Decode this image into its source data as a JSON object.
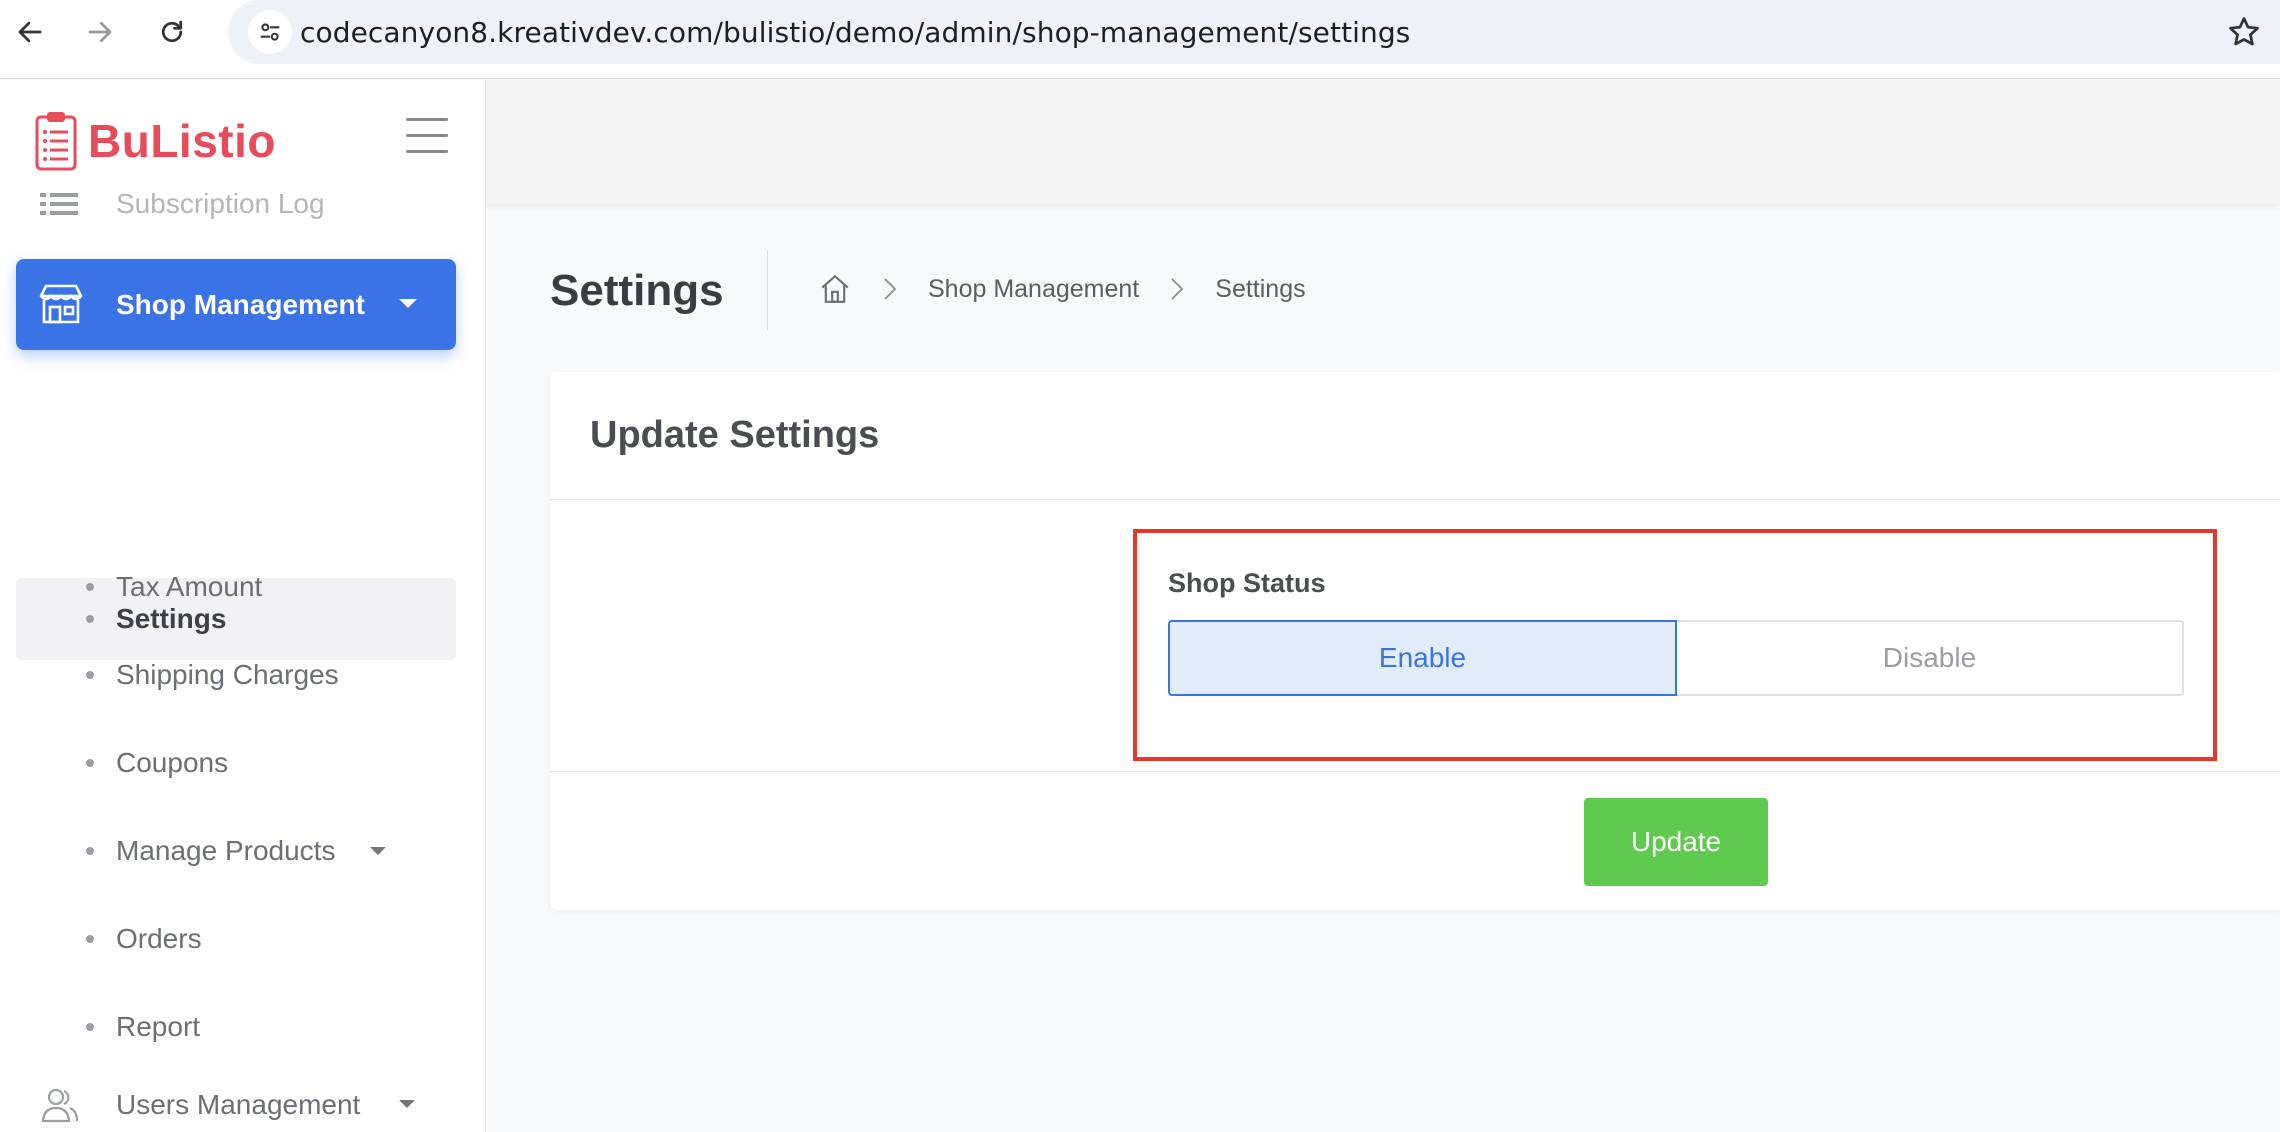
{
  "browser": {
    "url": "codecanyon8.kreativdev.com/bulistio/demo/admin/shop-management/settings"
  },
  "brand": {
    "name": "BuListio"
  },
  "sidebar": {
    "faded_item": "Subscription Log",
    "active_group": "Shop Management",
    "sub_items": [
      {
        "label": "Settings"
      },
      {
        "label": "Tax Amount"
      },
      {
        "label": "Shipping Charges"
      },
      {
        "label": "Coupons"
      },
      {
        "label": "Manage Products"
      },
      {
        "label": "Orders"
      },
      {
        "label": "Report"
      }
    ],
    "next_group": "Users Management"
  },
  "page": {
    "title": "Settings",
    "breadcrumb": [
      "Shop Management",
      "Settings"
    ]
  },
  "card": {
    "title": "Update Settings",
    "field_label": "Shop Status",
    "options": {
      "enable": "Enable",
      "disable": "Disable"
    },
    "selected": "Enable",
    "submit": "Update"
  },
  "colors": {
    "accent": "#3a73e6",
    "brand": "#e84c5a",
    "success": "#5ecb4f",
    "highlight": "#e3392a"
  }
}
